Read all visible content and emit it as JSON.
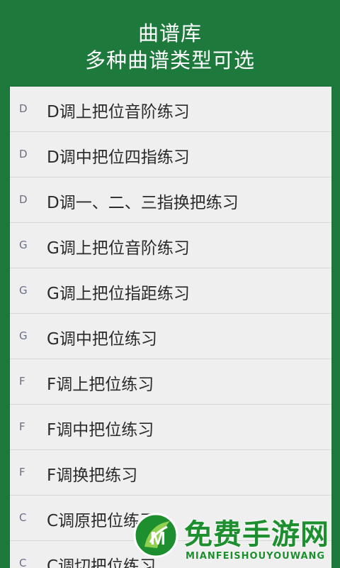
{
  "header": {
    "title": "曲谱库",
    "subtitle": "多种曲谱类型可选"
  },
  "list": {
    "items": [
      {
        "letter": "D",
        "label": "D调上把位音阶练习"
      },
      {
        "letter": "D",
        "label": "D调中把位四指练习"
      },
      {
        "letter": "D",
        "label": "D调一、二、三指换把练习"
      },
      {
        "letter": "G",
        "label": "G调上把位音阶练习"
      },
      {
        "letter": "G",
        "label": "G调上把位指距练习"
      },
      {
        "letter": "G",
        "label": "G调中把位练习"
      },
      {
        "letter": "F",
        "label": "F调上把位练习"
      },
      {
        "letter": "F",
        "label": "F调中把位练习"
      },
      {
        "letter": "F",
        "label": "F调换把练习"
      },
      {
        "letter": "C",
        "label": "C调原把位练习"
      },
      {
        "letter": "C",
        "label": "C调切把位练习"
      }
    ]
  },
  "watermark": {
    "text": "免费手游网",
    "sub": "MIANFEISHOUYOUWANG"
  },
  "colors": {
    "background": "#1e7a3c",
    "list_bg": "#efefef",
    "accent": "#1d8f2f"
  }
}
